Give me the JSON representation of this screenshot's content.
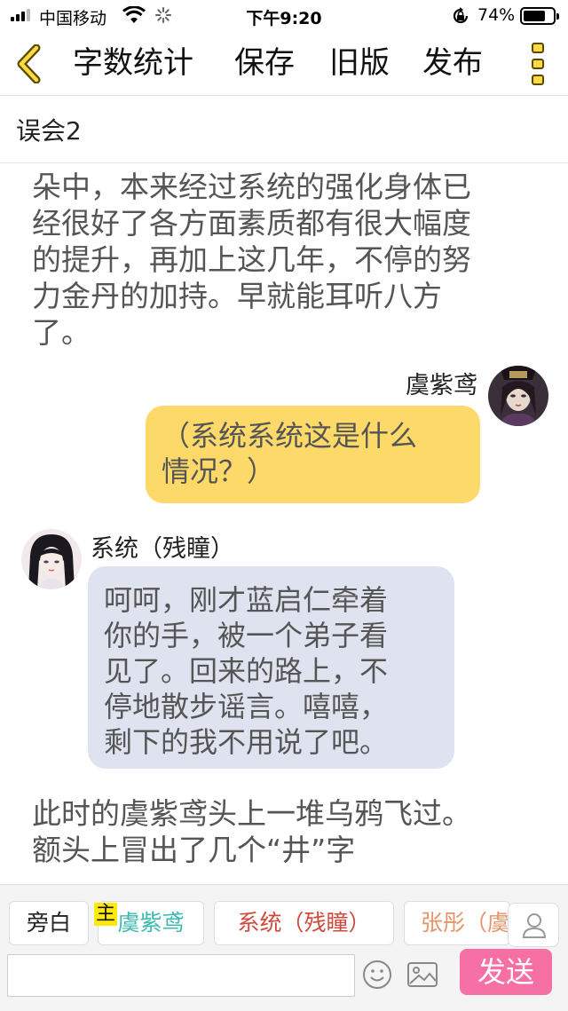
{
  "status_bar": {
    "carrier": "中国移动",
    "time": "下午9:20",
    "battery_percent": "74%",
    "battery_level": 0.74
  },
  "toolbar": {
    "word_count": "字数统计",
    "save": "保存",
    "old_version": "旧版",
    "publish": "发布"
  },
  "chapter": {
    "title": "误会2"
  },
  "messages": {
    "narration_1": "朵中，本来经过系统的强化身体已\n经很好了各方面素质都有很大幅度\n的提升，再加上这几年，不停的努\n力金丹的加持。早就能耳听八方\n了。",
    "right_speaker": "虞紫鸢",
    "right_text": "（系统系统这是什么\n情况？）",
    "left_speaker": "系统（残瞳）",
    "left_text": "呵呵，刚才蓝启仁牵着\n你的手，被一个弟子看\n见了。回来的路上，不\n停地散步谣言。嘻嘻，\n剩下的我不用说了吧。",
    "narration_2": "此时的虞紫鸢头上一堆乌鸦飞过。\n额头上冒出了几个“井”字"
  },
  "input_area": {
    "roles": [
      "旁白",
      "虞紫鸢",
      "系统（残瞳）",
      "张彤（虞"
    ],
    "main_badge": "主",
    "input_value": "",
    "send": "发送"
  },
  "colors": {
    "right_bubble": "#fdd96a",
    "left_bubble": "#dfe3ef",
    "send_button": "#f66fa5",
    "role_yu": "#3cb9b1",
    "role_system": "#d04a3c",
    "role_zhang": "#e6946a"
  },
  "icons": [
    "signal-icon",
    "wifi-icon",
    "loading-icon",
    "orientation-lock-icon",
    "battery-icon",
    "back-chevron-icon",
    "more-icon",
    "user-icon",
    "emoji-icon",
    "image-icon"
  ]
}
